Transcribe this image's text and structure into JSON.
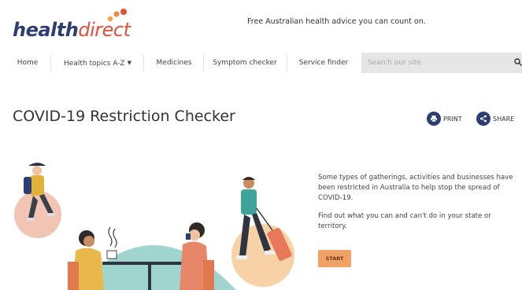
{
  "header": {
    "logo": {
      "part1": "health",
      "part2": "direct"
    },
    "tagline": "Free Australian health advice you can count on."
  },
  "nav": {
    "items": [
      {
        "label": "Home"
      },
      {
        "label": "Health topics A-Z",
        "has_dropdown": true
      },
      {
        "label": "Medicines"
      },
      {
        "label": "Symptom checker"
      },
      {
        "label": "Service finder"
      }
    ],
    "search_placeholder": "Search our site"
  },
  "page": {
    "title": "COVID-19 Restriction Checker",
    "print_label": "PRINT",
    "share_label": "SHARE"
  },
  "content": {
    "paragraph1": "Some types of gatherings, activities and businesses have been restricted in Australia to help stop the spread of COVID-19.",
    "paragraph2": "Find out what you can and can't do in your state or territory.",
    "start_label": "START"
  },
  "colors": {
    "brand_navy": "#2c3e72",
    "brand_red": "#e0503c",
    "start_button": "#f0a266"
  }
}
